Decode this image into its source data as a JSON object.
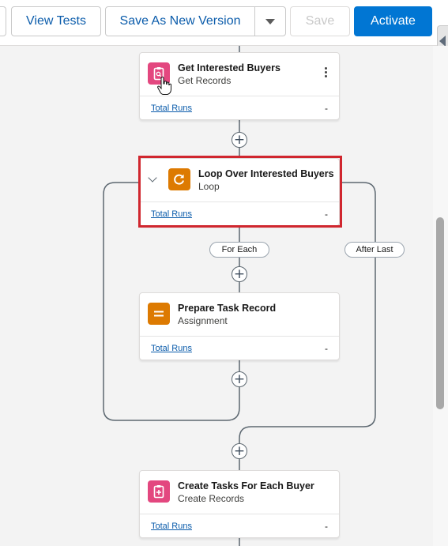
{
  "toolbar": {
    "view_tests_label": "View Tests",
    "save_as_new_version_label": "Save As New Version",
    "save_label": "Save",
    "activate_label": "Activate",
    "accent_color": "#0176d3"
  },
  "canvas": {
    "nodes": [
      {
        "title": "Get Interested Buyers",
        "type": "Get Records",
        "runs_label": "Total Runs",
        "runs_value": "-",
        "icon": "get-records-icon",
        "color": "#e3477f"
      },
      {
        "title": "Loop Over Interested Buyers",
        "type": "Loop",
        "runs_label": "Total Runs",
        "runs_value": "-",
        "icon": "loop-icon",
        "color": "#dd7a01",
        "highlighted": true
      },
      {
        "title": "Prepare Task Record",
        "type": "Assignment",
        "runs_label": "Total Runs",
        "runs_value": "-",
        "icon": "assignment-icon",
        "color": "#dd7a01"
      },
      {
        "title": "Create Tasks For Each Buyer",
        "type": "Create Records",
        "runs_label": "Total Runs",
        "runs_value": "-",
        "icon": "create-records-icon",
        "color": "#e3477f"
      }
    ],
    "loop_labels": {
      "for_each": "For Each",
      "after_last": "After Last"
    },
    "plus_symbol": "+",
    "highlight_color": "#d0262e"
  }
}
